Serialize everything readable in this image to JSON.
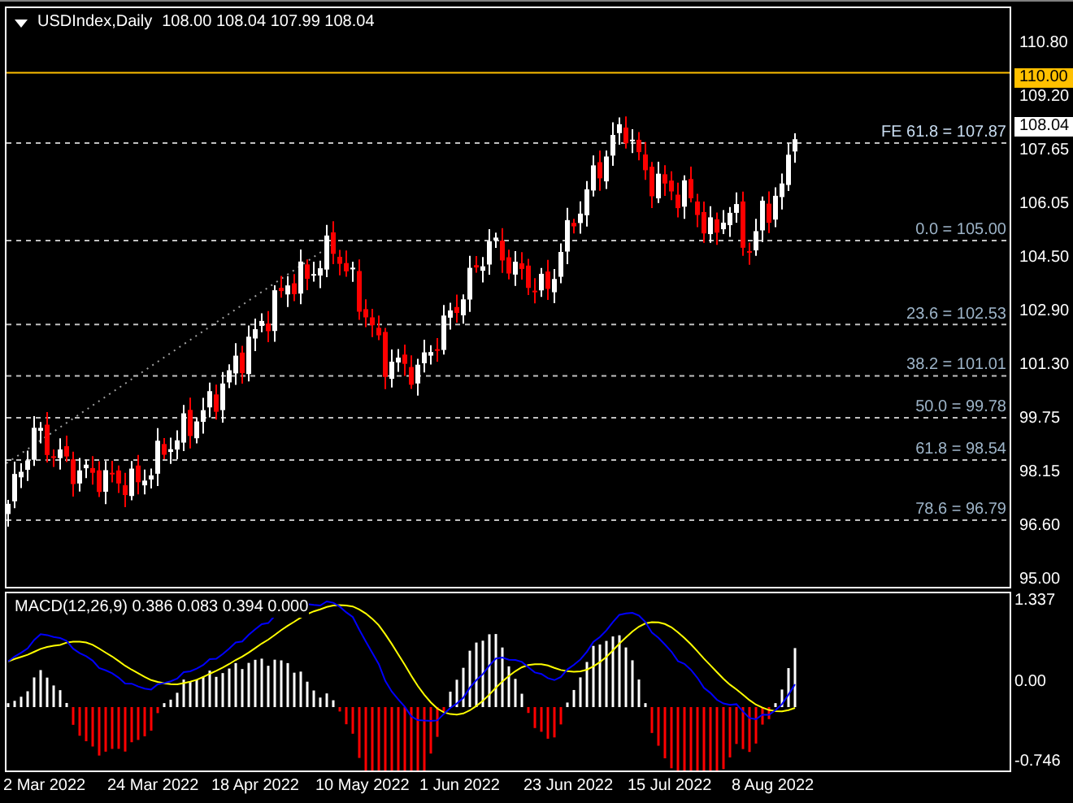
{
  "chart": {
    "symbol": "USDIndex,Daily",
    "quote": "108.00 108.04 107.99 108.04",
    "price_axis": [
      "110.80",
      "109.20",
      "107.65",
      "106.05",
      "104.50",
      "102.90",
      "101.30",
      "99.75",
      "98.15",
      "96.60",
      "95.00"
    ],
    "level_line": {
      "label": "110.00"
    },
    "current_price": "108.04",
    "fibonacci_levels": [
      {
        "label": "FE 61.8 = 107.87",
        "kind": "expansion"
      },
      {
        "label": "0.0 = 105.00",
        "kind": "retracement"
      },
      {
        "label": "23.6 = 102.53",
        "kind": "retracement"
      },
      {
        "label": "38.2 = 101.01",
        "kind": "retracement"
      },
      {
        "label": "50.0 = 99.78",
        "kind": "retracement"
      },
      {
        "label": "61.8 = 98.54",
        "kind": "retracement"
      },
      {
        "label": "78.6 = 96.79",
        "kind": "retracement"
      }
    ]
  },
  "macd": {
    "label": "MACD(12,26,9) 0.386 0.083 0.394 0.000",
    "axis": [
      "1.337",
      "0.00",
      "-0.746"
    ]
  },
  "date_axis": [
    "2 Mar 2022",
    "24 Mar 2022",
    "18 Apr 2022",
    "10 May 2022",
    "1 Jun 2022",
    "23 Jun 2022",
    "15 Jul 2022",
    "8 Aug 2022"
  ]
}
